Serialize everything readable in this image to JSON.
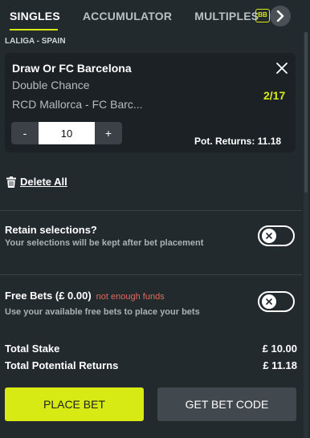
{
  "tabs": [
    {
      "label": "SINGLES",
      "active": true
    },
    {
      "label": "ACCUMULATOR",
      "active": false
    },
    {
      "label": "MULTIPLES",
      "active": false
    }
  ],
  "tab_extra_icon": {
    "name": "bet-builder-icon",
    "text": "BB"
  },
  "league": "LALIGA - SPAIN",
  "selection": {
    "title": "Draw Or FC Barcelona",
    "market": "Double Chance",
    "event": "RCD Mallorca - FC Barc...",
    "odds": "2/17",
    "stake_value": "10",
    "minus_label": "-",
    "plus_label": "+",
    "pot_returns": "Pot. Returns: 11.18"
  },
  "delete_all_label": "Delete All",
  "retain": {
    "title": "Retain selections?",
    "description": "Your selections will be kept after bet placement"
  },
  "free_bets": {
    "title": "Free Bets (£ 0.00)",
    "warning": "not enough funds",
    "description": "Use your available free bets to place your bets"
  },
  "totals": {
    "stake_label": "Total Stake",
    "stake_value": "£ 10.00",
    "returns_label": "Total Potential Returns",
    "returns_value": "£ 11.18"
  },
  "buttons": {
    "place_bet": "PLACE BET",
    "bet_code": "GET BET CODE"
  },
  "colors": {
    "accent": "#d8ea13",
    "background": "#232a2e",
    "card": "#1b2125",
    "warning": "#e06a5c"
  }
}
